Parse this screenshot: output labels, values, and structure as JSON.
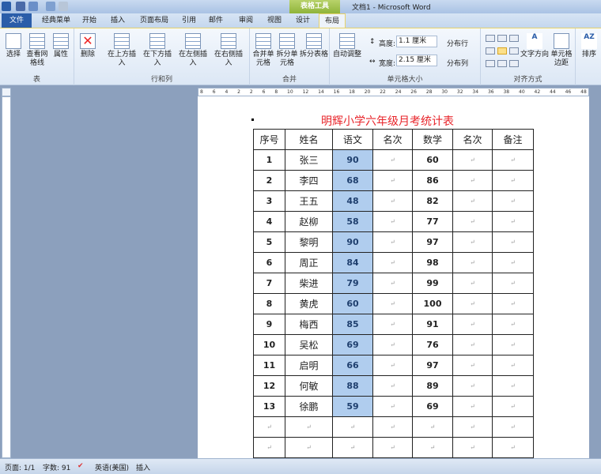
{
  "window": {
    "title": "文档1 - Microsoft Word",
    "context_tab_group": "表格工具"
  },
  "tabs": [
    "文件",
    "经典菜单",
    "开始",
    "插入",
    "页面布局",
    "引用",
    "邮件",
    "审阅",
    "视图",
    "设计",
    "布局"
  ],
  "ribbon": {
    "groups": {
      "table": "表",
      "rows_cols": "行和列",
      "merge": "合并",
      "cell_size": "单元格大小",
      "alignment": "对齐方式"
    },
    "select": "选择",
    "view_gridlines": "查看网格线",
    "properties": "属性",
    "delete": "删除",
    "insert_above": "在上方插入",
    "insert_below": "在下方插入",
    "insert_left": "在左侧插入",
    "insert_right": "在右侧插入",
    "merge_cells": "合并单元格",
    "split_cells": "拆分单元格",
    "split_table": "拆分表格",
    "autofit": "自动调整",
    "height_label": "高度:",
    "height_value": "1.1 厘米",
    "width_label": "宽度:",
    "width_value": "2.15 厘米",
    "distribute_rows": "分布行",
    "distribute_cols": "分布列",
    "text_direction": "文字方向",
    "cell_margins": "单元格边距",
    "sort": "排序"
  },
  "ruler": [
    "8",
    "6",
    "4",
    "2",
    "2",
    "6",
    "8",
    "10",
    "12",
    "14",
    "16",
    "18",
    "20",
    "22",
    "24",
    "26",
    "28",
    "30",
    "32",
    "34",
    "36",
    "38",
    "40",
    "42",
    "44",
    "46",
    "48"
  ],
  "document": {
    "title": "明辉小学六年级月考统计表",
    "headers": [
      "序号",
      "姓名",
      "语文",
      "名次",
      "数学",
      "名次",
      "备注"
    ],
    "rows": [
      [
        "1",
        "张三",
        "90",
        "60"
      ],
      [
        "2",
        "李四",
        "68",
        "86"
      ],
      [
        "3",
        "王五",
        "48",
        "82"
      ],
      [
        "4",
        "赵柳",
        "58",
        "77"
      ],
      [
        "5",
        "黎明",
        "90",
        "97"
      ],
      [
        "6",
        "周正",
        "84",
        "98"
      ],
      [
        "7",
        "柴进",
        "79",
        "99"
      ],
      [
        "8",
        "黄虎",
        "60",
        "100"
      ],
      [
        "9",
        "梅西",
        "85",
        "91"
      ],
      [
        "10",
        "吴松",
        "69",
        "76"
      ],
      [
        "11",
        "启明",
        "66",
        "97"
      ],
      [
        "12",
        "何敏",
        "88",
        "89"
      ],
      [
        "13",
        "徐鹏",
        "59",
        "69"
      ]
    ],
    "mark": "↵"
  },
  "status": {
    "page": "页面: 1/1",
    "words": "字数: 91",
    "language": "英语(美国)",
    "mode": "插入"
  }
}
